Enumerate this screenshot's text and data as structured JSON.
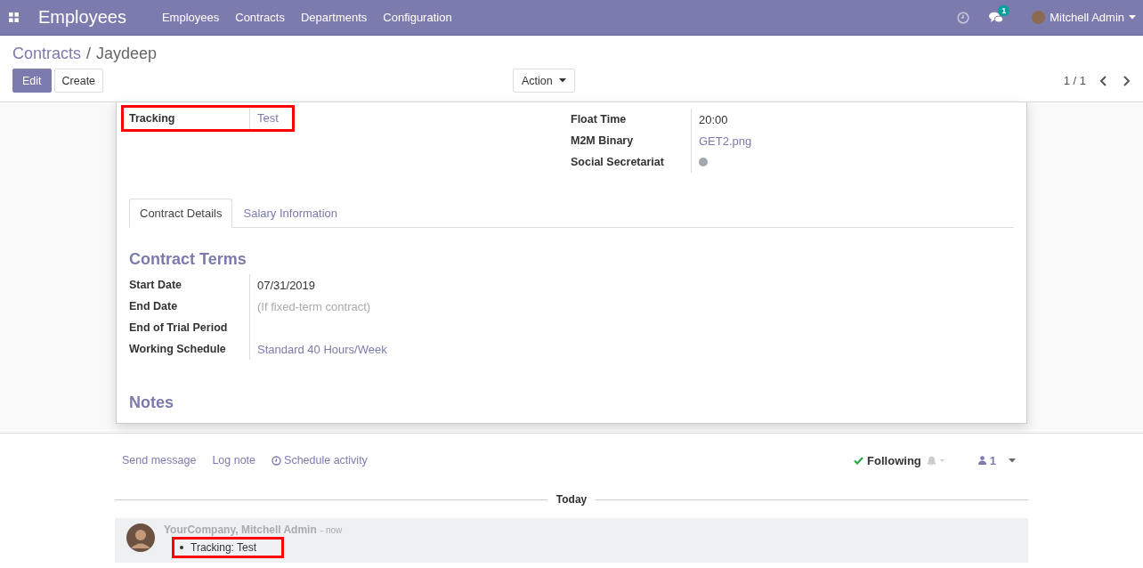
{
  "navbar": {
    "app_title": "Employees",
    "menu": [
      "Employees",
      "Contracts",
      "Departments",
      "Configuration"
    ],
    "messages_badge": "1",
    "user": "Mitchell Admin"
  },
  "breadcrumb": {
    "items": [
      "Contracts",
      "Jaydeep"
    ],
    "separator": "/"
  },
  "buttons": {
    "edit": "Edit",
    "create": "Create",
    "action": "Action"
  },
  "pager": "1 / 1",
  "left_fields": [
    {
      "label": "Tracking",
      "value": "Test",
      "kind": "link",
      "highlighted": true
    }
  ],
  "right_fields": [
    {
      "label": "Float Time",
      "value": "20:00",
      "kind": "text"
    },
    {
      "label": "M2M Binary",
      "value": "GET2.png",
      "kind": "link"
    },
    {
      "label": "Social Secretariat",
      "kind": "dot",
      "color": "#a0a7ae"
    }
  ],
  "tabs": [
    {
      "label": "Contract Details",
      "selected": true
    },
    {
      "label": "Salary Information",
      "selected": false
    }
  ],
  "contract_terms": {
    "title": "Contract Terms",
    "fields": [
      {
        "label": "Start Date",
        "value": "07/31/2019",
        "kind": "text"
      },
      {
        "label": "End Date",
        "placeholder": "(If fixed-term contract)",
        "kind": "placeholder"
      },
      {
        "label": "End of Trial Period",
        "kind": "empty"
      },
      {
        "label": "Working Schedule",
        "value": "Standard 40 Hours/Week",
        "kind": "link"
      }
    ]
  },
  "notes_title": "Notes",
  "chatter": {
    "actions": [
      "Send message",
      "Log note",
      "Schedule activity"
    ],
    "following": "Following",
    "followers": "1",
    "date_separator": "Today",
    "messages": [
      {
        "author": "YourCompany, Mitchell Admin",
        "time": "- now",
        "tracking": "Tracking: Test",
        "highlighted": true
      }
    ]
  }
}
